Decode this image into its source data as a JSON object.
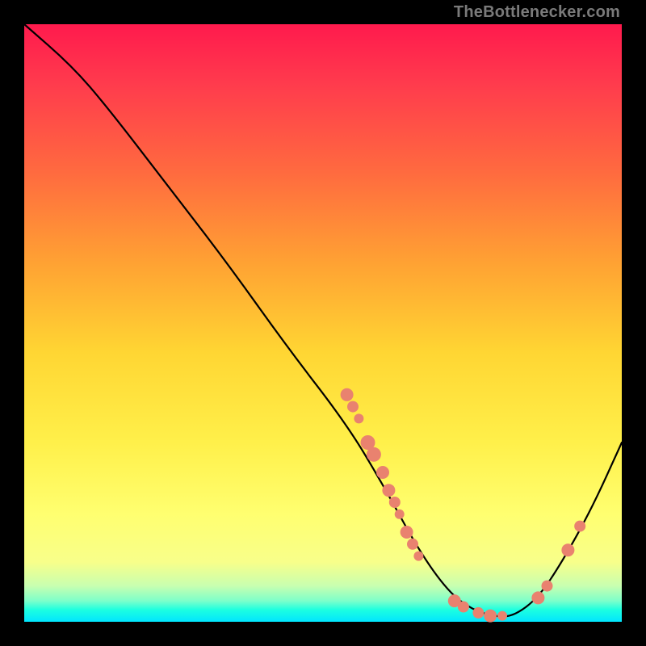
{
  "watermark": "TheBottlenecker.com",
  "chart_data": {
    "type": "line",
    "title": "",
    "xlabel": "",
    "ylabel": "",
    "xlim": [
      0,
      100
    ],
    "ylim": [
      0,
      100
    ],
    "series": [
      {
        "name": "curve",
        "points": [
          {
            "x": 0,
            "y": 100
          },
          {
            "x": 8,
            "y": 93
          },
          {
            "x": 14,
            "y": 86
          },
          {
            "x": 24,
            "y": 73
          },
          {
            "x": 34,
            "y": 60
          },
          {
            "x": 44,
            "y": 46
          },
          {
            "x": 54,
            "y": 33
          },
          {
            "x": 60,
            "y": 23
          },
          {
            "x": 66,
            "y": 12
          },
          {
            "x": 71,
            "y": 5
          },
          {
            "x": 75,
            "y": 2
          },
          {
            "x": 79,
            "y": 0.8
          },
          {
            "x": 82,
            "y": 1
          },
          {
            "x": 86,
            "y": 4
          },
          {
            "x": 90,
            "y": 10
          },
          {
            "x": 95,
            "y": 19
          },
          {
            "x": 100,
            "y": 30
          }
        ]
      }
    ],
    "scatter_points": [
      {
        "x": 54,
        "y": 38,
        "r": 8
      },
      {
        "x": 55,
        "y": 36,
        "r": 7
      },
      {
        "x": 56,
        "y": 34,
        "r": 6
      },
      {
        "x": 57.5,
        "y": 30,
        "r": 9
      },
      {
        "x": 58.5,
        "y": 28,
        "r": 9
      },
      {
        "x": 60,
        "y": 25,
        "r": 8
      },
      {
        "x": 61,
        "y": 22,
        "r": 8
      },
      {
        "x": 62,
        "y": 20,
        "r": 7
      },
      {
        "x": 62.8,
        "y": 18,
        "r": 6
      },
      {
        "x": 64,
        "y": 15,
        "r": 8
      },
      {
        "x": 65,
        "y": 13,
        "r": 7
      },
      {
        "x": 66,
        "y": 11,
        "r": 6
      },
      {
        "x": 72,
        "y": 3.5,
        "r": 8
      },
      {
        "x": 73.5,
        "y": 2.5,
        "r": 7
      },
      {
        "x": 76,
        "y": 1.5,
        "r": 7
      },
      {
        "x": 78,
        "y": 1,
        "r": 8
      },
      {
        "x": 80,
        "y": 1,
        "r": 6
      },
      {
        "x": 86,
        "y": 4,
        "r": 8
      },
      {
        "x": 87.5,
        "y": 6,
        "r": 7
      },
      {
        "x": 91,
        "y": 12,
        "r": 8
      },
      {
        "x": 93,
        "y": 16,
        "r": 7
      }
    ],
    "colors": {
      "curve": "#000000",
      "points": "#e9826f",
      "gradient_top": "#ff1a4d",
      "gradient_bottom": "#00e5ff"
    }
  }
}
